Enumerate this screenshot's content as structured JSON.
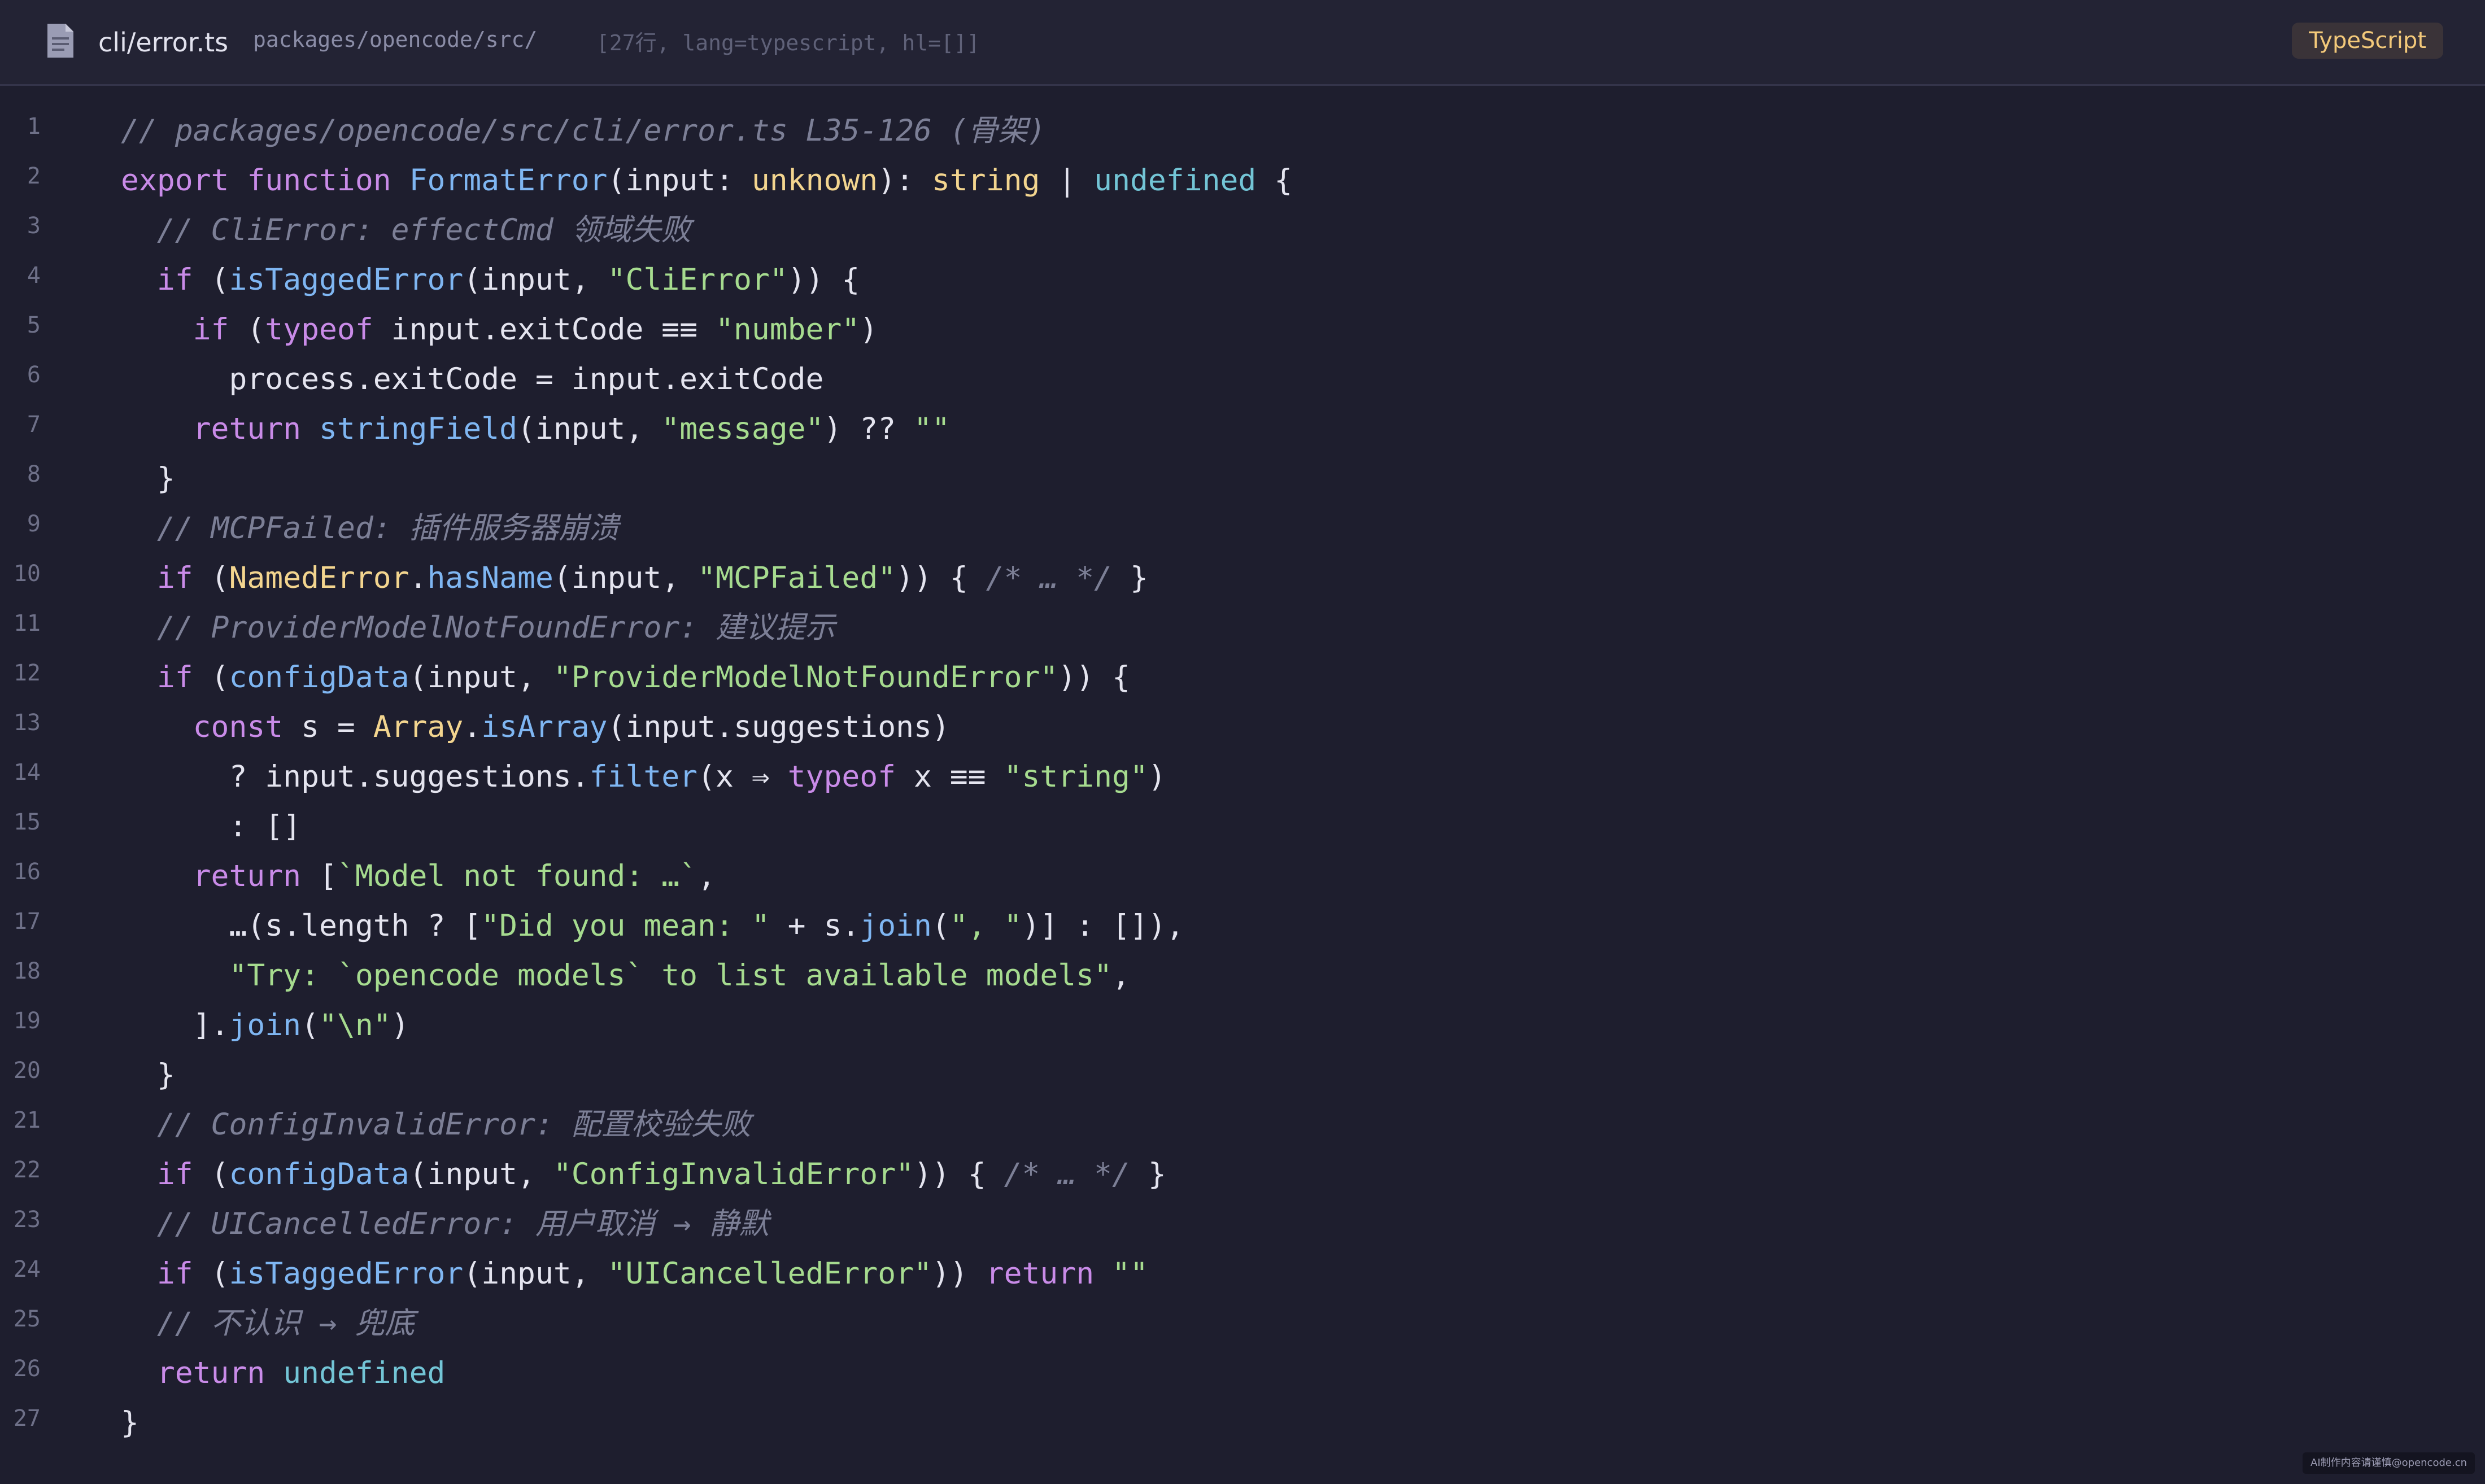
{
  "header": {
    "file_icon": "document-icon",
    "file_name": "cli/error.ts",
    "path": "packages/opencode/src/",
    "meta": "[27行, lang=typescript, hl=[]]",
    "language_badge": "TypeScript"
  },
  "code": {
    "lines": [
      {
        "n": "1",
        "tokens": [
          {
            "t": "// packages/opencode/src/cli/error.ts L35-126 (骨架)",
            "c": "comment"
          }
        ]
      },
      {
        "n": "2",
        "tokens": [
          {
            "t": "export",
            "c": "kw"
          },
          {
            "t": " ",
            "c": "plain"
          },
          {
            "t": "function",
            "c": "kw"
          },
          {
            "t": " ",
            "c": "plain"
          },
          {
            "t": "FormatError",
            "c": "fn"
          },
          {
            "t": "(input: ",
            "c": "plain"
          },
          {
            "t": "unknown",
            "c": "type"
          },
          {
            "t": "): ",
            "c": "plain"
          },
          {
            "t": "string",
            "c": "type"
          },
          {
            "t": " | ",
            "c": "plain"
          },
          {
            "t": "undefined",
            "c": "const"
          },
          {
            "t": " {",
            "c": "plain"
          }
        ]
      },
      {
        "n": "3",
        "tokens": [
          {
            "t": "  // CliError: effectCmd 领域失败",
            "c": "comment"
          }
        ]
      },
      {
        "n": "4",
        "tokens": [
          {
            "t": "  ",
            "c": "plain"
          },
          {
            "t": "if",
            "c": "kw"
          },
          {
            "t": " (",
            "c": "plain"
          },
          {
            "t": "isTaggedError",
            "c": "fn"
          },
          {
            "t": "(input, ",
            "c": "plain"
          },
          {
            "t": "\"CliError\"",
            "c": "str"
          },
          {
            "t": ")) {",
            "c": "plain"
          }
        ]
      },
      {
        "n": "5",
        "tokens": [
          {
            "t": "    ",
            "c": "plain"
          },
          {
            "t": "if",
            "c": "kw"
          },
          {
            "t": " (",
            "c": "plain"
          },
          {
            "t": "typeof",
            "c": "kw"
          },
          {
            "t": " input.exitCode ≡≡ ",
            "c": "plain"
          },
          {
            "t": "\"number\"",
            "c": "str"
          },
          {
            "t": ")",
            "c": "plain"
          }
        ]
      },
      {
        "n": "6",
        "tokens": [
          {
            "t": "      process.exitCode = input.exitCode",
            "c": "plain"
          }
        ]
      },
      {
        "n": "7",
        "tokens": [
          {
            "t": "    ",
            "c": "plain"
          },
          {
            "t": "return",
            "c": "kw"
          },
          {
            "t": " ",
            "c": "plain"
          },
          {
            "t": "stringField",
            "c": "fn"
          },
          {
            "t": "(input, ",
            "c": "plain"
          },
          {
            "t": "\"message\"",
            "c": "str"
          },
          {
            "t": ") ?? ",
            "c": "plain"
          },
          {
            "t": "\"\"",
            "c": "str"
          }
        ]
      },
      {
        "n": "8",
        "tokens": [
          {
            "t": "  }",
            "c": "plain"
          }
        ]
      },
      {
        "n": "9",
        "tokens": [
          {
            "t": "  // MCPFailed: 插件服务器崩溃",
            "c": "comment"
          }
        ]
      },
      {
        "n": "10",
        "tokens": [
          {
            "t": "  ",
            "c": "plain"
          },
          {
            "t": "if",
            "c": "kw"
          },
          {
            "t": " (",
            "c": "plain"
          },
          {
            "t": "NamedError",
            "c": "type"
          },
          {
            "t": ".",
            "c": "plain"
          },
          {
            "t": "hasName",
            "c": "fn"
          },
          {
            "t": "(input, ",
            "c": "plain"
          },
          {
            "t": "\"MCPFailed\"",
            "c": "str"
          },
          {
            "t": ")) { ",
            "c": "plain"
          },
          {
            "t": "/* … */",
            "c": "comment"
          },
          {
            "t": " }",
            "c": "plain"
          }
        ]
      },
      {
        "n": "11",
        "tokens": [
          {
            "t": "  // ProviderModelNotFoundError: 建议提示",
            "c": "comment"
          }
        ]
      },
      {
        "n": "12",
        "tokens": [
          {
            "t": "  ",
            "c": "plain"
          },
          {
            "t": "if",
            "c": "kw"
          },
          {
            "t": " (",
            "c": "plain"
          },
          {
            "t": "configData",
            "c": "fn"
          },
          {
            "t": "(input, ",
            "c": "plain"
          },
          {
            "t": "\"ProviderModelNotFoundError\"",
            "c": "str"
          },
          {
            "t": ")) {",
            "c": "plain"
          }
        ]
      },
      {
        "n": "13",
        "tokens": [
          {
            "t": "    ",
            "c": "plain"
          },
          {
            "t": "const",
            "c": "kw"
          },
          {
            "t": " s = ",
            "c": "plain"
          },
          {
            "t": "Array",
            "c": "type"
          },
          {
            "t": ".",
            "c": "plain"
          },
          {
            "t": "isArray",
            "c": "fn"
          },
          {
            "t": "(input.suggestions)",
            "c": "plain"
          }
        ]
      },
      {
        "n": "14",
        "tokens": [
          {
            "t": "      ? input.suggestions.",
            "c": "plain"
          },
          {
            "t": "filter",
            "c": "fn"
          },
          {
            "t": "(x ⇒ ",
            "c": "plain"
          },
          {
            "t": "typeof",
            "c": "kw"
          },
          {
            "t": " x ≡≡ ",
            "c": "plain"
          },
          {
            "t": "\"string\"",
            "c": "str"
          },
          {
            "t": ")",
            "c": "plain"
          }
        ]
      },
      {
        "n": "15",
        "tokens": [
          {
            "t": "      : []",
            "c": "plain"
          }
        ]
      },
      {
        "n": "16",
        "tokens": [
          {
            "t": "    ",
            "c": "plain"
          },
          {
            "t": "return",
            "c": "kw"
          },
          {
            "t": " [",
            "c": "plain"
          },
          {
            "t": "`Model not found: …`",
            "c": "str"
          },
          {
            "t": ",",
            "c": "plain"
          }
        ]
      },
      {
        "n": "17",
        "tokens": [
          {
            "t": "      …(s.length ? [",
            "c": "plain"
          },
          {
            "t": "\"Did you mean: \"",
            "c": "str"
          },
          {
            "t": " + s.",
            "c": "plain"
          },
          {
            "t": "join",
            "c": "fn"
          },
          {
            "t": "(",
            "c": "plain"
          },
          {
            "t": "\", \"",
            "c": "str"
          },
          {
            "t": ")] : []),",
            "c": "plain"
          }
        ]
      },
      {
        "n": "18",
        "tokens": [
          {
            "t": "      ",
            "c": "plain"
          },
          {
            "t": "\"Try: `opencode models` to list available models\"",
            "c": "str"
          },
          {
            "t": ",",
            "c": "plain"
          }
        ]
      },
      {
        "n": "19",
        "tokens": [
          {
            "t": "    ].",
            "c": "plain"
          },
          {
            "t": "join",
            "c": "fn"
          },
          {
            "t": "(",
            "c": "plain"
          },
          {
            "t": "\"\\n\"",
            "c": "str"
          },
          {
            "t": ")",
            "c": "plain"
          }
        ]
      },
      {
        "n": "20",
        "tokens": [
          {
            "t": "  }",
            "c": "plain"
          }
        ]
      },
      {
        "n": "21",
        "tokens": [
          {
            "t": "  // ConfigInvalidError: 配置校验失败",
            "c": "comment"
          }
        ]
      },
      {
        "n": "22",
        "tokens": [
          {
            "t": "  ",
            "c": "plain"
          },
          {
            "t": "if",
            "c": "kw"
          },
          {
            "t": " (",
            "c": "plain"
          },
          {
            "t": "configData",
            "c": "fn"
          },
          {
            "t": "(input, ",
            "c": "plain"
          },
          {
            "t": "\"ConfigInvalidError\"",
            "c": "str"
          },
          {
            "t": ")) { ",
            "c": "plain"
          },
          {
            "t": "/* … */",
            "c": "comment"
          },
          {
            "t": " }",
            "c": "plain"
          }
        ]
      },
      {
        "n": "23",
        "tokens": [
          {
            "t": "  // UICancelledError: 用户取消 → 静默",
            "c": "comment"
          }
        ]
      },
      {
        "n": "24",
        "tokens": [
          {
            "t": "  ",
            "c": "plain"
          },
          {
            "t": "if",
            "c": "kw"
          },
          {
            "t": " (",
            "c": "plain"
          },
          {
            "t": "isTaggedError",
            "c": "fn"
          },
          {
            "t": "(input, ",
            "c": "plain"
          },
          {
            "t": "\"UICancelledError\"",
            "c": "str"
          },
          {
            "t": ")) ",
            "c": "plain"
          },
          {
            "t": "return",
            "c": "kw"
          },
          {
            "t": " ",
            "c": "plain"
          },
          {
            "t": "\"\"",
            "c": "str"
          }
        ]
      },
      {
        "n": "25",
        "tokens": [
          {
            "t": "  // 不认识 → 兜底",
            "c": "comment"
          }
        ]
      },
      {
        "n": "26",
        "tokens": [
          {
            "t": "  ",
            "c": "plain"
          },
          {
            "t": "return",
            "c": "kw"
          },
          {
            "t": " ",
            "c": "plain"
          },
          {
            "t": "undefined",
            "c": "const"
          }
        ]
      },
      {
        "n": "27",
        "tokens": [
          {
            "t": "}",
            "c": "plain"
          }
        ]
      }
    ]
  },
  "watermark": "AI制作内容请谨慎@opencode.cn"
}
